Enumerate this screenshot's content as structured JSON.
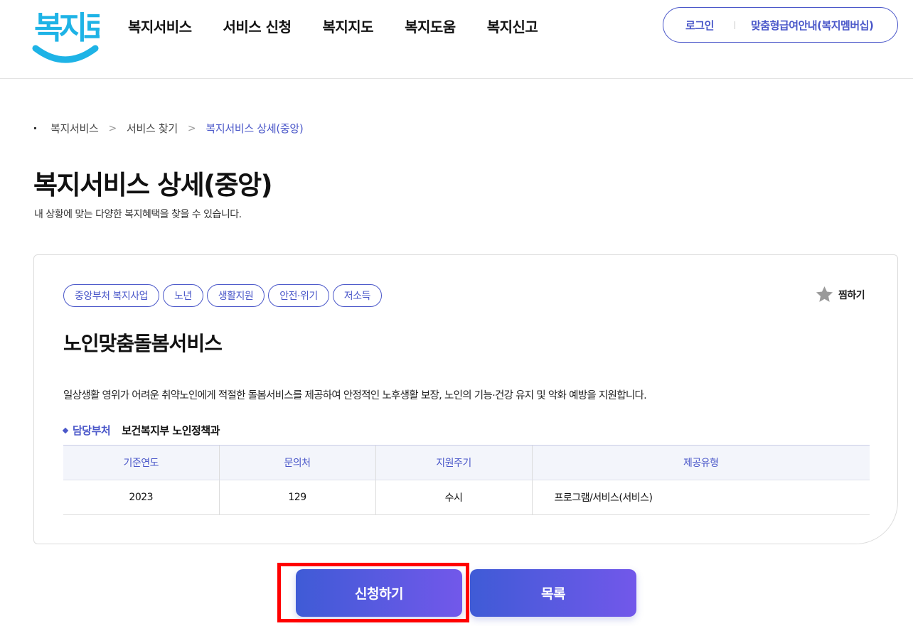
{
  "header": {
    "logo_text": "복지로",
    "nav": [
      "복지서비스",
      "서비스 신청",
      "복지지도",
      "복지도움",
      "복지신고"
    ],
    "login": "로그인",
    "custom_benefit": "맞춤형급여안내(복지멤버십)"
  },
  "breadcrumb": {
    "items": [
      "복지서비스",
      "서비스 찾기"
    ],
    "current": "복지서비스 상세(중앙)"
  },
  "page": {
    "title": "복지서비스 상세(중앙)",
    "subtitle": "내 상황에 맞는 다양한 복지혜택을 찾을 수 있습니다."
  },
  "service": {
    "tags": [
      "중앙부처 복지사업",
      "노년",
      "생활지원",
      "안전·위기",
      "저소득"
    ],
    "bookmark_label": "찜하기",
    "title": "노인맞춤돌봄서비스",
    "description": "일상생활 영위가 어려운 취약노인에게 적절한 돌봄서비스를 제공하여 안정적인 노후생활 보장, 노인의 기능·건강 유지 및 악화 예방을 지원합니다.",
    "dept_label": "담당부처",
    "dept_value": "보건복지부 노인정책과",
    "table": {
      "headers": [
        "기준연도",
        "문의처",
        "지원주기",
        "제공유형"
      ],
      "row": [
        "2023",
        "129",
        "수시",
        "프로그램/서비스(서비스)"
      ]
    }
  },
  "actions": {
    "apply": "신청하기",
    "list": "목록"
  },
  "colors": {
    "accent": "#4a57c9",
    "logo_blue": "#1eb3e6",
    "button_gradient_start": "#3f5bd6",
    "button_gradient_end": "#7258ea",
    "highlight": "#ff0000"
  }
}
